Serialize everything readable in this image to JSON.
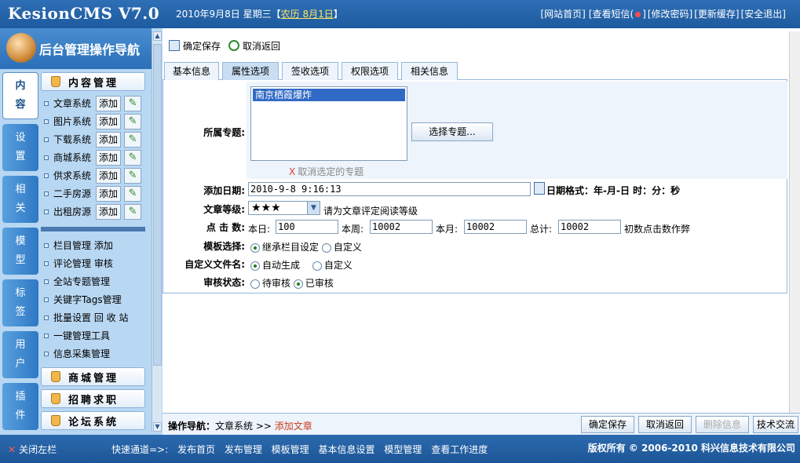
{
  "header": {
    "logo": "KesionCMS V7.0",
    "date": "2010年9月8日 星期三【",
    "lunar": "农历 8月1日",
    "date_end": "】",
    "links": [
      "[网站首页]",
      "[查看短信(",
      "●",
      "]",
      "[修改密码]",
      "[更新缓存]",
      "[安全退出]"
    ]
  },
  "sidebar": {
    "title": "后台管理操作导航",
    "tabs": [
      {
        "label": "内容"
      },
      {
        "label": "设置"
      },
      {
        "label": "相关"
      },
      {
        "label": "模型"
      },
      {
        "label": "标签"
      },
      {
        "label": "用户"
      },
      {
        "label": "插件"
      }
    ],
    "content_header": "内容管理",
    "systems": [
      {
        "label": "文章系统",
        "add": "添加"
      },
      {
        "label": "图片系统",
        "add": "添加"
      },
      {
        "label": "下载系统",
        "add": "添加"
      },
      {
        "label": "商城系统",
        "add": "添加"
      },
      {
        "label": "供求系统",
        "add": "添加"
      },
      {
        "label": "二手房源",
        "add": "添加"
      },
      {
        "label": "出租房源",
        "add": "添加"
      }
    ],
    "links": [
      "栏目管理 添加",
      "评论管理 审核",
      "全站专题管理",
      "关键字Tags管理",
      "批量设置 回 收 站",
      "一键管理工具",
      "信息采集管理"
    ],
    "categories": [
      "商城管理",
      "招聘求职",
      "论坛系统"
    ]
  },
  "toolbar": {
    "save": "确定保存",
    "cancel": "取消返回"
  },
  "tabs": [
    "基本信息",
    "属性选项",
    "签收选项",
    "权限选项",
    "相关信息"
  ],
  "form": {
    "topic_label": "所属专题:",
    "topic_option": "南京栖霞爆炸",
    "select_topic": "选择专题...",
    "cancel_topic": "取消选定的专题",
    "date_label": "添加日期:",
    "date_value": "2010-9-8 9:16:13",
    "date_format": "日期格式：年-月-日 时：分：秒",
    "rating_label": "文章等级:",
    "rating_value": "★★★",
    "rating_hint": "请为文章评定阅读等级",
    "hits_label": "点 击 数:",
    "today_label": "本日:",
    "today": "100",
    "week_label": "本周:",
    "week": "10002",
    "month_label": "本月:",
    "month": "10002",
    "total_label": "总计:",
    "total": "10002",
    "hits_hint": "初数点击数作弊",
    "template_label": "模板选择:",
    "template_opt1": "继承栏目设定",
    "template_opt2": "自定义",
    "filename_label": "自定义文件名:",
    "filename_opt1": "自动生成",
    "filename_opt2": "自定义",
    "status_label": "审核状态:",
    "status_opt1": "待审核",
    "status_opt2": "已审核"
  },
  "footer": {
    "nav_label": "操作导航：",
    "nav_section": "文章系统",
    "nav_sep": ">>",
    "nav_current": "添加文章",
    "buttons": [
      "确定保存",
      "取消返回",
      "删除信息",
      "技术交流"
    ]
  },
  "statusbar": {
    "close": "关闭左栏",
    "quick_label": "快速通道=>:",
    "quick": [
      "发布首页",
      "发布管理",
      "模板管理",
      "基本信息设置",
      "模型管理",
      "查看工作进度"
    ],
    "copyright": "版权所有 © 2006-2010 科兴信息技术有限公司"
  }
}
